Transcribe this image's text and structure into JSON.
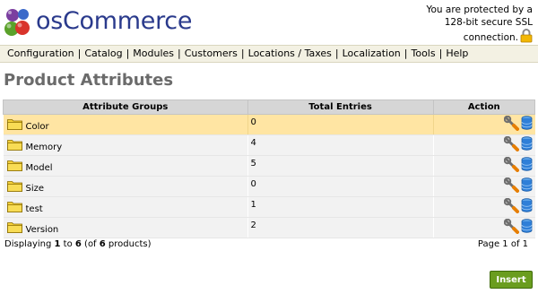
{
  "header": {
    "logo_text": "osCommerce",
    "ssl_line1": "You are protected by a",
    "ssl_line2": "128-bit secure SSL",
    "ssl_line3": "connection."
  },
  "menu": [
    "Configuration",
    "Catalog",
    "Modules",
    "Customers",
    "Locations / Taxes",
    "Localization",
    "Tools",
    "Help"
  ],
  "page_title": "Product Attributes",
  "table": {
    "headers": [
      "Attribute Groups",
      "Total Entries",
      "Action"
    ],
    "rows": [
      {
        "name": "Color",
        "total": "0",
        "selected": true
      },
      {
        "name": "Memory",
        "total": "4",
        "selected": false
      },
      {
        "name": "Model",
        "total": "5",
        "selected": false
      },
      {
        "name": "Size",
        "total": "0",
        "selected": false
      },
      {
        "name": "test",
        "total": "1",
        "selected": false
      },
      {
        "name": "Version",
        "total": "2",
        "selected": false
      }
    ]
  },
  "paging": {
    "displaying_prefix": "Displaying ",
    "from": "1",
    "to_word": " to ",
    "to": "6",
    "of_prefix": " (of ",
    "total": "6",
    "of_suffix": " products)",
    "page_label": "Page 1 of 1"
  },
  "insert_label": "Insert",
  "icons": {
    "logo": "oscommerce-logo-icon",
    "lock": "lock-icon",
    "folder": "folder-icon",
    "edit": "wrench-edit-icon",
    "delete": "database-delete-icon"
  },
  "colors": {
    "menubar_bg": "#f3f1e3",
    "selected_row": "#ffe5a3",
    "insert_button": "#6a9d1f",
    "title": "#6b6b6b"
  }
}
